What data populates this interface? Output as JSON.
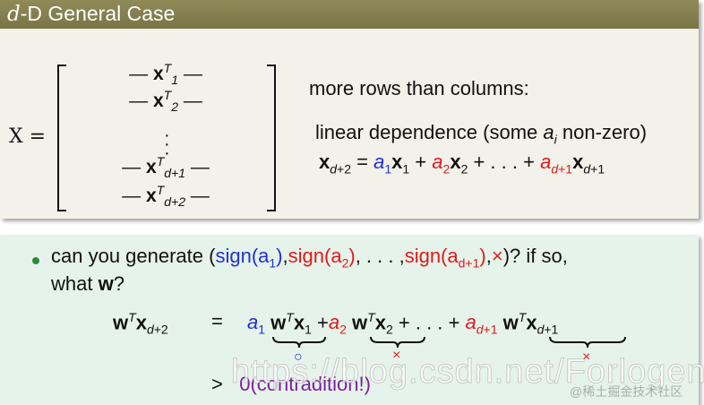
{
  "title_var": "d",
  "title_rest": "-D General Case",
  "matrix": {
    "lhs": "X =",
    "row1_sub": "1",
    "row2_sub": "2",
    "row4_sub": "d+1",
    "row5_sub": "d+2",
    "sup": "T"
  },
  "right": {
    "rows_text": "more rows than columns:",
    "lindep_pre": "linear dependence (some ",
    "lindep_var": "a",
    "lindep_sub": "i",
    "lindep_post": " non-zero)"
  },
  "bullet": {
    "pre": "can you generate (",
    "s1": "sign(a",
    "s1_sub": "1",
    "s2": "sign(a",
    "s2_sub": "2",
    "s3": "sign(a",
    "s3_sub": "d+1",
    "times": "×",
    "post": ")? if so,",
    "line2_pre": "what ",
    "line2_w": "w",
    "line2_post": "?"
  },
  "eq": {
    "lhs_sub": "d+2",
    "eq": "=",
    "mark1": "○",
    "mark2": "×",
    "mark3": "×",
    "gt": ">",
    "result": "0(contradition!)"
  },
  "watermarks": {
    "url": "https://blog.csdn.net/Forlogen",
    "credit": "@稀土掘金技术社区"
  }
}
